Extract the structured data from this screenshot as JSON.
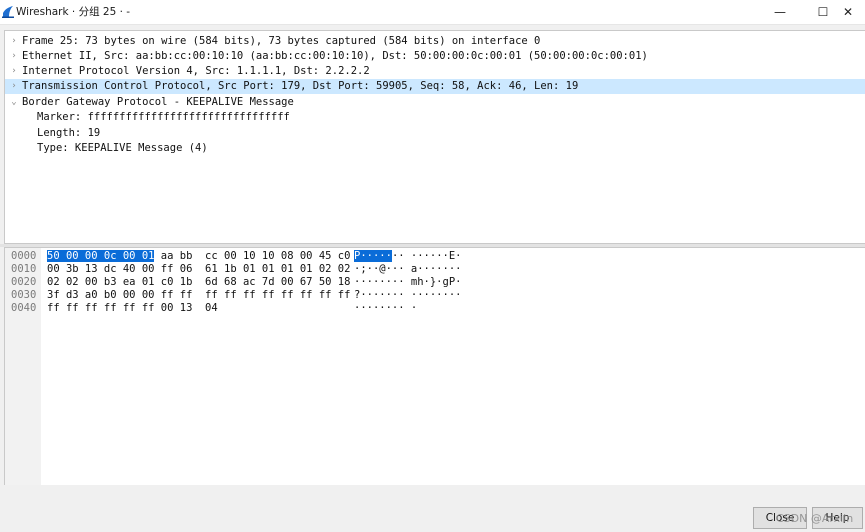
{
  "window": {
    "title": "Wireshark · 分组 25 · -",
    "minimize_glyph": "—",
    "maximize_glyph": "☐",
    "close_glyph": "✕"
  },
  "icons": {
    "app": "wireshark-fin-icon",
    "collapsed": "chevron-right-icon",
    "expanded": "chevron-down-icon"
  },
  "colors": {
    "selected_row": "#cce8ff",
    "byte_highlight": "#0a6cd8"
  },
  "detail": {
    "rows": [
      {
        "text": "Frame 25: 73 bytes on wire (584 bits), 73 bytes captured (584 bits) on interface 0",
        "chevron": "›"
      },
      {
        "text": "Ethernet II, Src: aa:bb:cc:00:10:10 (aa:bb:cc:00:10:10), Dst: 50:00:00:0c:00:01 (50:00:00:0c:00:01)",
        "chevron": "›"
      },
      {
        "text": "Internet Protocol Version 4, Src: 1.1.1.1, Dst: 2.2.2.2",
        "chevron": "›"
      },
      {
        "text": "Transmission Control Protocol, Src Port: 179, Dst Port: 59905, Seq: 58, Ack: 46, Len: 19",
        "chevron": "›",
        "selected": true
      },
      {
        "text": "Border Gateway Protocol - KEEPALIVE Message",
        "chevron": "⌄",
        "expanded": true
      }
    ],
    "bgp_children": [
      "Marker: ffffffffffffffffffffffffffffffff",
      "Length: 19",
      "Type: KEEPALIVE Message (4)"
    ]
  },
  "bytes": {
    "lines": [
      {
        "offset": "0000",
        "hex_hl": "50 00 00 0c 00 01",
        "hex_rest": " aa bb  cc 00 10 10 08 00 45 c0",
        "ascii_hl": "P·····",
        "ascii_rest": "·· ······E·"
      },
      {
        "offset": "0010",
        "hex_hl": "",
        "hex_rest": "00 3b 13 dc 40 00 ff 06  61 1b 01 01 01 01 02 02",
        "ascii_hl": "",
        "ascii_rest": "·;··@··· a·······"
      },
      {
        "offset": "0020",
        "hex_hl": "",
        "hex_rest": "02 02 00 b3 ea 01 c0 1b  6d 68 ac 7d 00 67 50 18",
        "ascii_hl": "",
        "ascii_rest": "········ mh·}·gP·"
      },
      {
        "offset": "0030",
        "hex_hl": "",
        "hex_rest": "3f d3 a0 b0 00 00 ff ff  ff ff ff ff ff ff ff ff",
        "ascii_hl": "",
        "ascii_rest": "?······· ········"
      },
      {
        "offset": "0040",
        "hex_hl": "",
        "hex_rest": "ff ff ff ff ff ff 00 13  04",
        "ascii_hl": "",
        "ascii_rest": "········ ·"
      }
    ]
  },
  "buttons": {
    "close": "Close",
    "help": "Help"
  },
  "watermark": "CSDN @Arxiln"
}
